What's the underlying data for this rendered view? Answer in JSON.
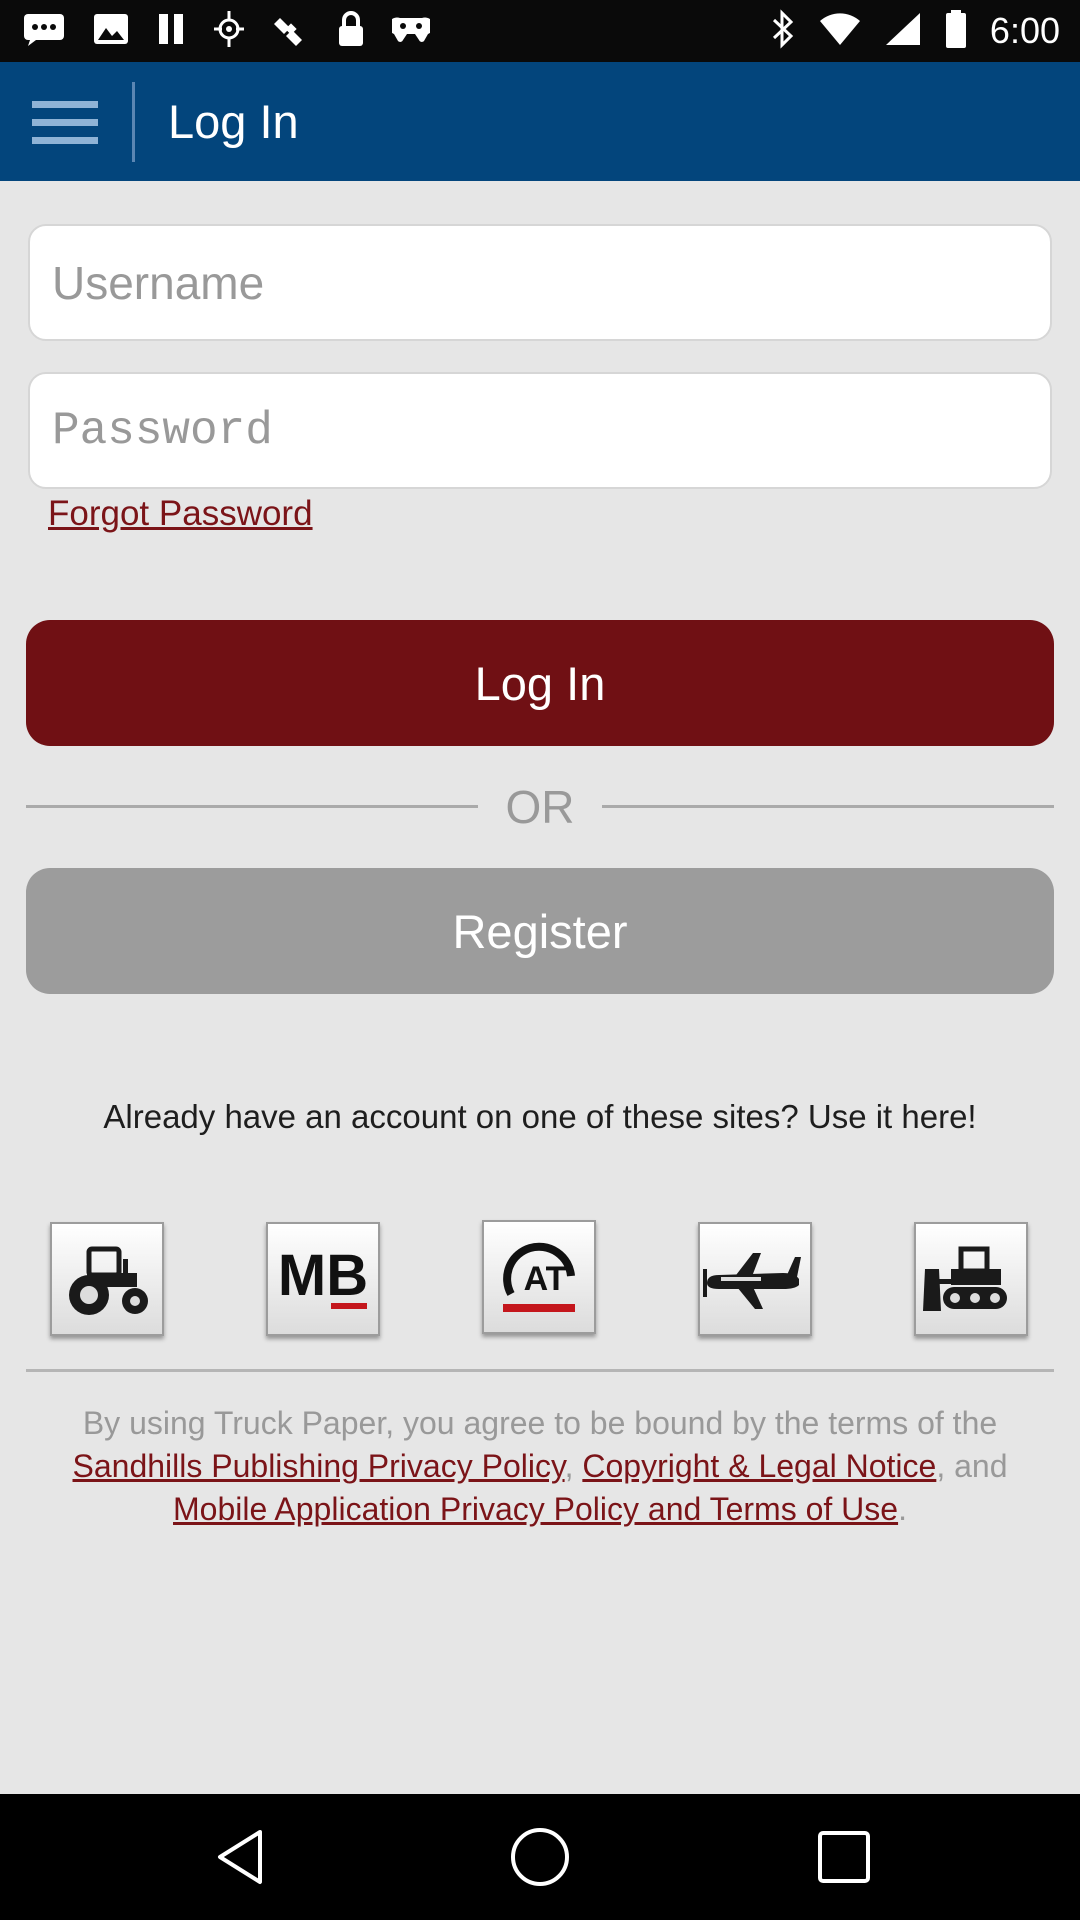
{
  "status_bar": {
    "time": "6:00",
    "left_icons": [
      "message-icon",
      "image-icon",
      "pause-icon",
      "fake-gps-icon",
      "location-satellite-icon",
      "lock-icon",
      "game-controller-icon"
    ],
    "right_icons": [
      "bluetooth-icon",
      "wifi-icon",
      "signal-icon",
      "battery-icon"
    ]
  },
  "app_bar": {
    "title": "Log In",
    "menu_icon": "hamburger-menu-icon",
    "background": "#03457c"
  },
  "form": {
    "username_placeholder": "Username",
    "password_placeholder": "Password",
    "forgot_password": "Forgot Password",
    "login_button": "Log In",
    "or_text": "OR",
    "register_button": "Register"
  },
  "sites": {
    "prompt": "Already have an account on one of these sites? Use it here!",
    "icons": [
      {
        "name": "tractor-icon",
        "label": ""
      },
      {
        "name": "mb-logo-icon",
        "label": "MB"
      },
      {
        "name": "at-logo-icon",
        "label": "AT"
      },
      {
        "name": "airplane-icon",
        "label": ""
      },
      {
        "name": "bulldozer-icon",
        "label": ""
      }
    ]
  },
  "terms": {
    "prefix": "By using Truck Paper, you agree to be bound by the terms of the ",
    "link1": "Sandhills Publishing Privacy Policy",
    "sep1": ", ",
    "link2": "Copyright & Legal Notice",
    "sep2": ", and ",
    "link3": "Mobile Application Privacy Policy and Terms of Use",
    "suffix": "."
  },
  "colors": {
    "accent_red": "#701014",
    "link_red": "#7b1418",
    "register_gray": "#9c9c9c",
    "background": "#e6e6e6"
  },
  "nav_bar": {
    "icons": [
      "back-icon",
      "home-icon",
      "recent-apps-icon"
    ]
  }
}
